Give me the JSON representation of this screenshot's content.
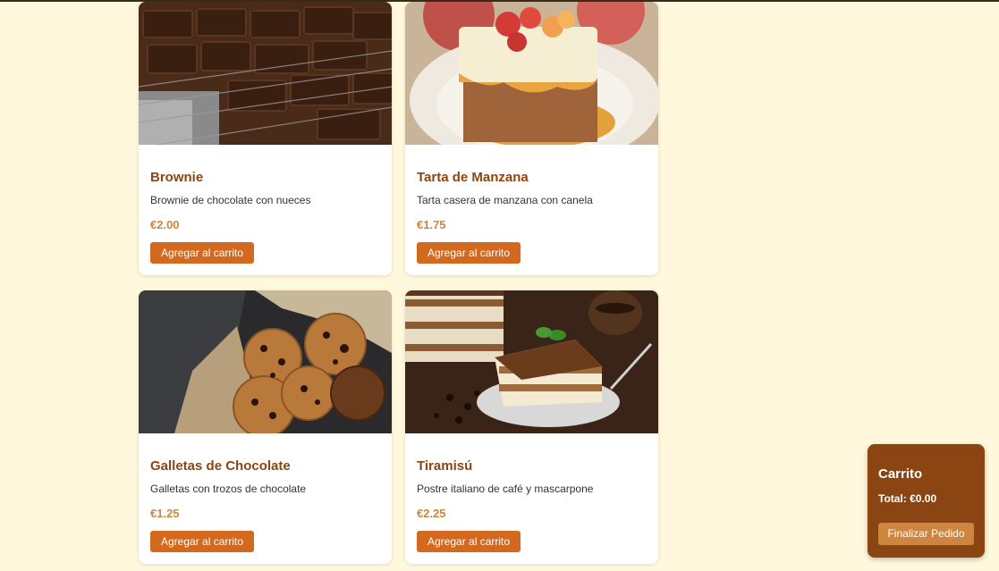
{
  "products": [
    {
      "name": "Brownie",
      "description": "Brownie de chocolate con nueces",
      "price": "€2.00",
      "button_label": "Agregar al carrito"
    },
    {
      "name": "Tarta de Manzana",
      "description": "Tarta casera de manzana con canela",
      "price": "€1.75",
      "button_label": "Agregar al carrito"
    },
    {
      "name": "Galletas de Chocolate",
      "description": "Galletas con trozos de chocolate",
      "price": "€1.25",
      "button_label": "Agregar al carrito"
    },
    {
      "name": "Tiramisú",
      "description": "Postre italiano de café y mascarpone",
      "price": "€2.25",
      "button_label": "Agregar al carrito"
    }
  ],
  "cart": {
    "title": "Carrito",
    "total": "Total: €0.00",
    "checkout_label": "Finalizar Pedido"
  },
  "colors": {
    "page_bg": "#fff8dc",
    "heading": "#8b4513",
    "price": "#cd853f",
    "button": "#d2691e",
    "cart_bg": "#8b4513"
  }
}
